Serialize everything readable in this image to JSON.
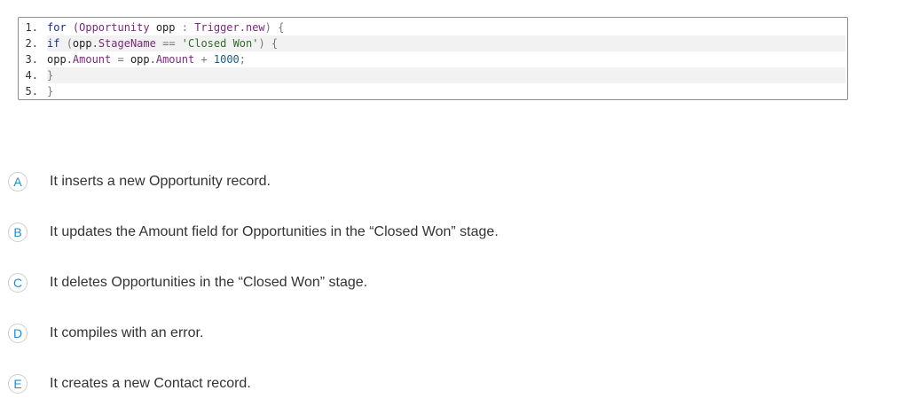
{
  "code": {
    "lines": [
      {
        "number": "1.",
        "tokens": [
          {
            "text": "for ",
            "cls": "t-kw"
          },
          {
            "text": "(Opportunity ",
            "cls": "t-cls"
          },
          {
            "text": "opp ",
            "cls": "t-plain"
          },
          {
            "text": ": ",
            "cls": "t-op"
          },
          {
            "text": "Trigger.new",
            "cls": "t-cls"
          },
          {
            "text": ") {",
            "cls": "t-op"
          }
        ]
      },
      {
        "number": "2.",
        "tokens": [
          {
            "text": "if ",
            "cls": "t-kw"
          },
          {
            "text": "(",
            "cls": "t-op"
          },
          {
            "text": "opp",
            "cls": "t-plain"
          },
          {
            "text": ".StageName ",
            "cls": "t-cls"
          },
          {
            "text": "== ",
            "cls": "t-op"
          },
          {
            "text": "'Closed Won'",
            "cls": "t-str"
          },
          {
            "text": ") {",
            "cls": "t-op"
          }
        ]
      },
      {
        "number": "3.",
        "tokens": [
          {
            "text": "opp",
            "cls": "t-plain"
          },
          {
            "text": ".Amount ",
            "cls": "t-cls"
          },
          {
            "text": "= ",
            "cls": "t-op"
          },
          {
            "text": "opp",
            "cls": "t-plain"
          },
          {
            "text": ".Amount ",
            "cls": "t-cls"
          },
          {
            "text": "+ ",
            "cls": "t-op"
          },
          {
            "text": "1000",
            "cls": "t-num"
          },
          {
            "text": ";",
            "cls": "t-op"
          }
        ]
      },
      {
        "number": "4.",
        "tokens": [
          {
            "text": "}",
            "cls": "t-op"
          }
        ]
      },
      {
        "number": "5.",
        "tokens": [
          {
            "text": "}",
            "cls": "t-op"
          }
        ]
      }
    ]
  },
  "options": [
    {
      "letter": "A",
      "text": "It inserts a new Opportunity record."
    },
    {
      "letter": "B",
      "text": "It updates the Amount field for Opportunities in the “Closed Won” stage."
    },
    {
      "letter": "C",
      "text": "It deletes Opportunities in the “Closed Won” stage."
    },
    {
      "letter": "D",
      "text": "It compiles with an error."
    },
    {
      "letter": "E",
      "text": "It creates a new Contact record."
    }
  ],
  "colors": {
    "option_letter": "#1f8fd6",
    "option_text": "#333333",
    "code_border": "#8c8c8c",
    "shaded_line": "#f2f2f2"
  }
}
